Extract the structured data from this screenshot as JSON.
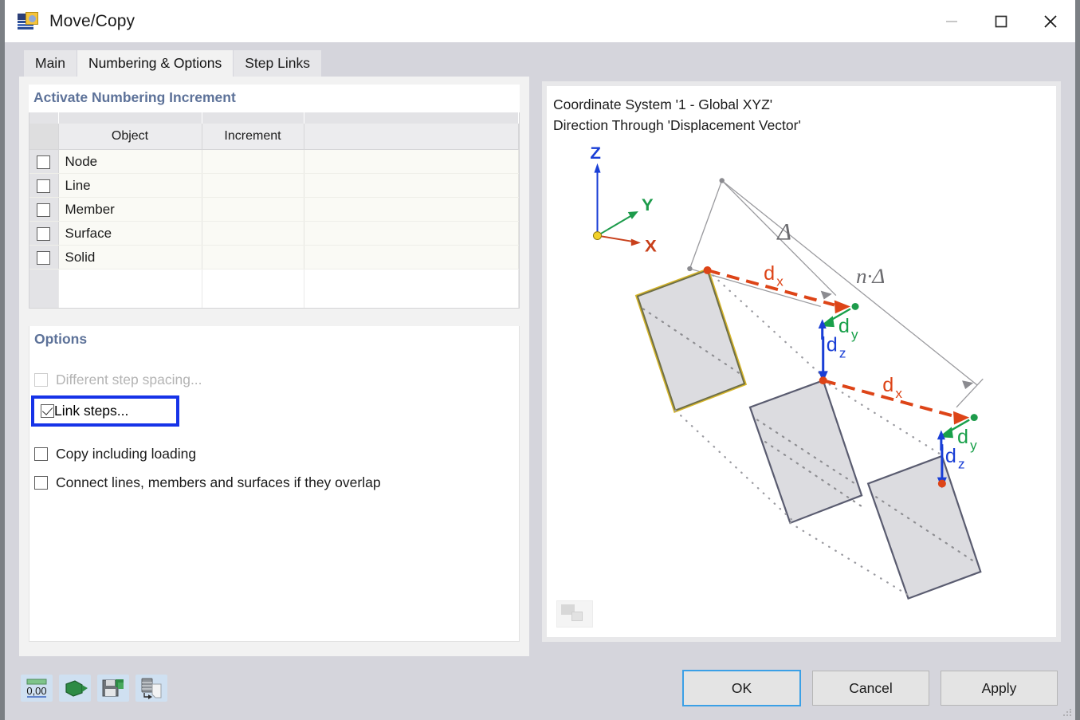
{
  "window": {
    "title": "Move/Copy",
    "icon": "move-copy-icon",
    "controls": {
      "minimize": "minimize-icon",
      "maximize": "maximize-icon",
      "close": "close-icon"
    }
  },
  "tabs": [
    {
      "label": "Main",
      "active": false
    },
    {
      "label": "Numbering & Options",
      "active": true
    },
    {
      "label": "Step Links",
      "active": false
    }
  ],
  "numbering": {
    "header": "Activate Numbering Increment",
    "columns": [
      "",
      "Object",
      "Increment",
      ""
    ],
    "rows": [
      {
        "checked": false,
        "object": "Node",
        "increment": ""
      },
      {
        "checked": false,
        "object": "Line",
        "increment": ""
      },
      {
        "checked": false,
        "object": "Member",
        "increment": ""
      },
      {
        "checked": false,
        "object": "Surface",
        "increment": ""
      },
      {
        "checked": false,
        "object": "Solid",
        "increment": ""
      }
    ]
  },
  "options": {
    "header": "Options",
    "items": [
      {
        "label": "Different step spacing...",
        "checked": false,
        "enabled": false,
        "highlighted": false
      },
      {
        "label": "Link steps...",
        "checked": true,
        "enabled": true,
        "highlighted": true
      },
      {
        "label": "Copy including loading",
        "checked": false,
        "enabled": true,
        "highlighted": false
      },
      {
        "label": "Connect lines, members and surfaces if they overlap",
        "checked": false,
        "enabled": true,
        "highlighted": false
      }
    ]
  },
  "preview": {
    "line1": "Coordinate System '1 - Global XYZ'",
    "line2": "Direction Through 'Displacement Vector'",
    "axes": {
      "x": "X",
      "y": "Y",
      "z": "Z"
    },
    "labels": {
      "delta": "Δ",
      "n_delta": "n·Δ",
      "dx": "d",
      "dx_sub": "x",
      "dy": "d",
      "dy_sub": "y",
      "dz": "d",
      "dz_sub": "z"
    },
    "colors": {
      "x_axis": "#c8401b",
      "y_axis": "#1d9b4b",
      "z_axis": "#1a3fd6",
      "dx": "#dd4417",
      "dy": "#19a04a",
      "dz": "#1a3fd6",
      "selected_surface": "#d6b52a",
      "surface_fill": "#dcdce0",
      "surface_stroke": "#5a5c70"
    },
    "bottom_icon": "image-placeholder-icon"
  },
  "footer": {
    "tools": [
      {
        "name": "units-settings-icon",
        "label": "0,00"
      },
      {
        "name": "view-mode-icon",
        "label": ""
      },
      {
        "name": "save-settings-icon",
        "label": ""
      },
      {
        "name": "import-settings-icon",
        "label": ""
      }
    ],
    "buttons": [
      {
        "label": "OK",
        "default": true
      },
      {
        "label": "Cancel",
        "default": false
      },
      {
        "label": "Apply",
        "default": false
      }
    ]
  },
  "theme": {
    "header_text": "#5d7299",
    "highlight_box": "#1633e8",
    "default_button_border": "#3ba0e6",
    "dialog_bg": "#d5d5dc"
  }
}
